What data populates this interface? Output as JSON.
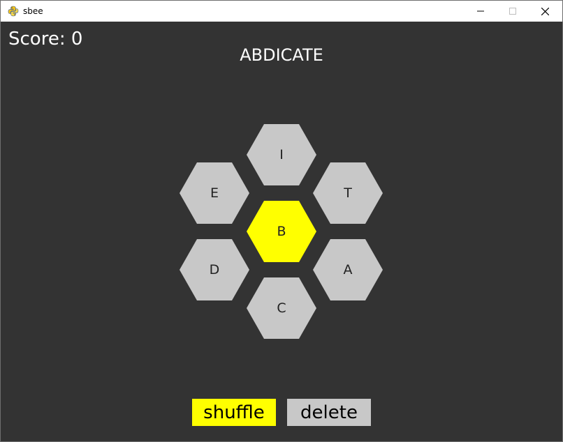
{
  "window": {
    "title": "sbee",
    "icon": "python-snake-icon"
  },
  "game": {
    "score_text": "Score: 0",
    "current_word": "ABDICATE",
    "center_letter": "B",
    "outer_letters": {
      "top": "I",
      "upper_left": "E",
      "upper_right": "T",
      "lower_left": "D",
      "lower_right": "A",
      "bottom": "C"
    },
    "buttons": {
      "shuffle_label": "shuffle",
      "delete_label": "delete"
    }
  },
  "colors": {
    "background": "#333333",
    "center_hex": "#ffff00",
    "outer_hex": "#c8c8c8",
    "shuffle_button": "#ffff00",
    "delete_button": "#c8c8c8",
    "text_light": "#ffffff"
  }
}
